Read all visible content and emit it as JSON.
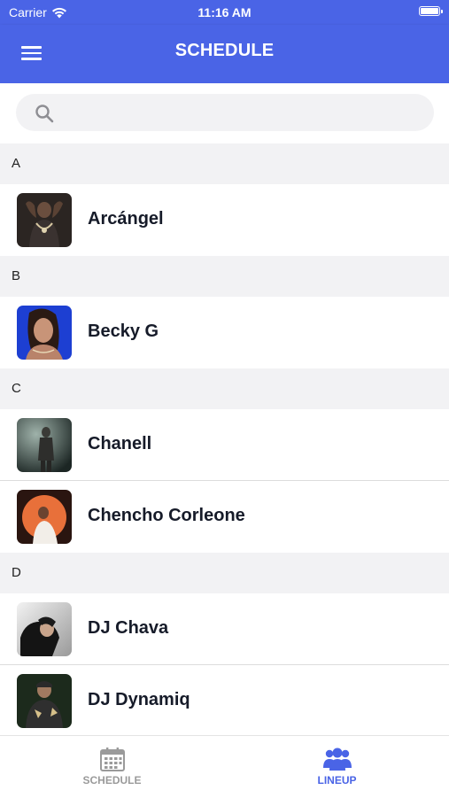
{
  "status_bar": {
    "carrier": "Carrier",
    "time": "11:16 AM"
  },
  "header": {
    "title": "SCHEDULE",
    "menu_icon": "hamburger-menu-icon"
  },
  "search": {
    "placeholder": "",
    "icon": "search-icon"
  },
  "lineup": [
    {
      "letter": "A",
      "artists": [
        {
          "name": "Arcángel"
        }
      ]
    },
    {
      "letter": "B",
      "artists": [
        {
          "name": "Becky G"
        }
      ]
    },
    {
      "letter": "C",
      "artists": [
        {
          "name": "Chanell"
        },
        {
          "name": "Chencho Corleone"
        }
      ]
    },
    {
      "letter": "D",
      "artists": [
        {
          "name": "DJ Chava"
        },
        {
          "name": "DJ Dynamiq"
        }
      ]
    }
  ],
  "tabs": [
    {
      "label": "SCHEDULE",
      "icon": "calendar-icon",
      "active": false
    },
    {
      "label": "LINEUP",
      "icon": "users-icon",
      "active": true
    }
  ],
  "colors": {
    "brand": "#4a64e6",
    "inactive_tab": "#9a9a9a",
    "section_bg": "#f2f2f4"
  }
}
